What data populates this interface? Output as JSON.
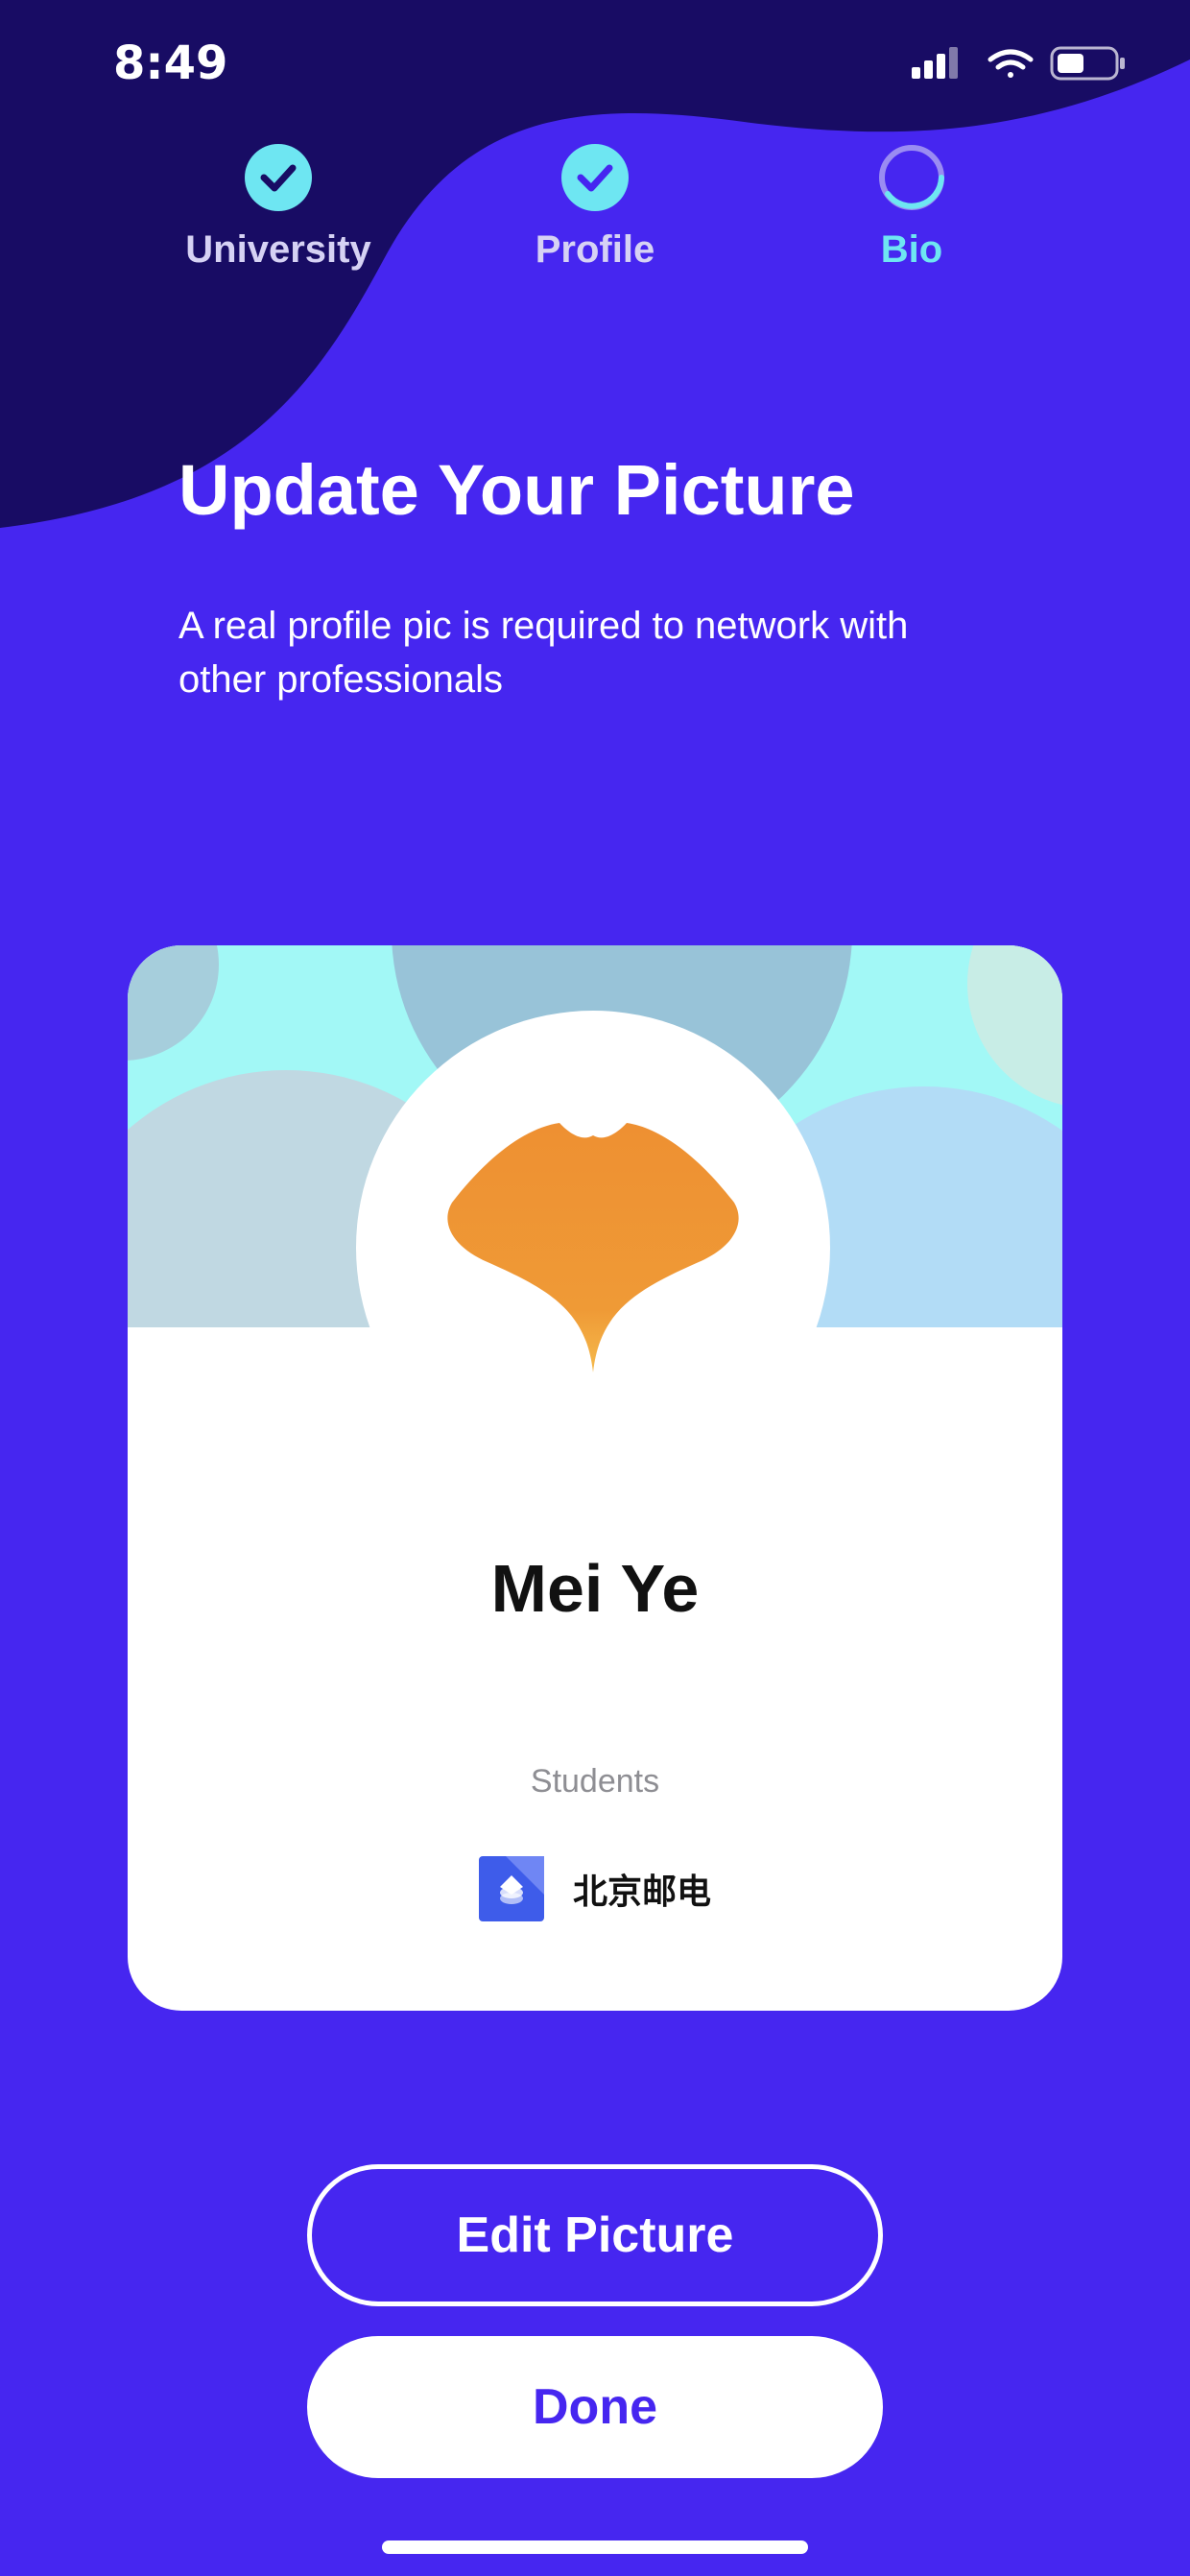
{
  "status_bar": {
    "time": "8:49"
  },
  "steps": [
    {
      "label": "University",
      "state": "done"
    },
    {
      "label": "Profile",
      "state": "done"
    },
    {
      "label": "Bio",
      "state": "in-progress"
    }
  ],
  "header": {
    "title": "Update Your Picture",
    "subtitle": "A real profile pic is required to network with other professionals"
  },
  "card": {
    "name": "Mei Ye",
    "role": "Students",
    "organization": "北京邮电"
  },
  "buttons": {
    "edit_label": "Edit Picture",
    "done_label": "Done"
  },
  "colors": {
    "background": "#4626F0",
    "wave": "#180C64",
    "accent": "#6EE6F2",
    "logo": "#EE9032"
  },
  "icons": [
    "check-circle-icon",
    "progress-ring-icon",
    "ginkgo-logo-icon",
    "university-logo-icon",
    "signal-icon",
    "wifi-icon",
    "battery-icon"
  ]
}
